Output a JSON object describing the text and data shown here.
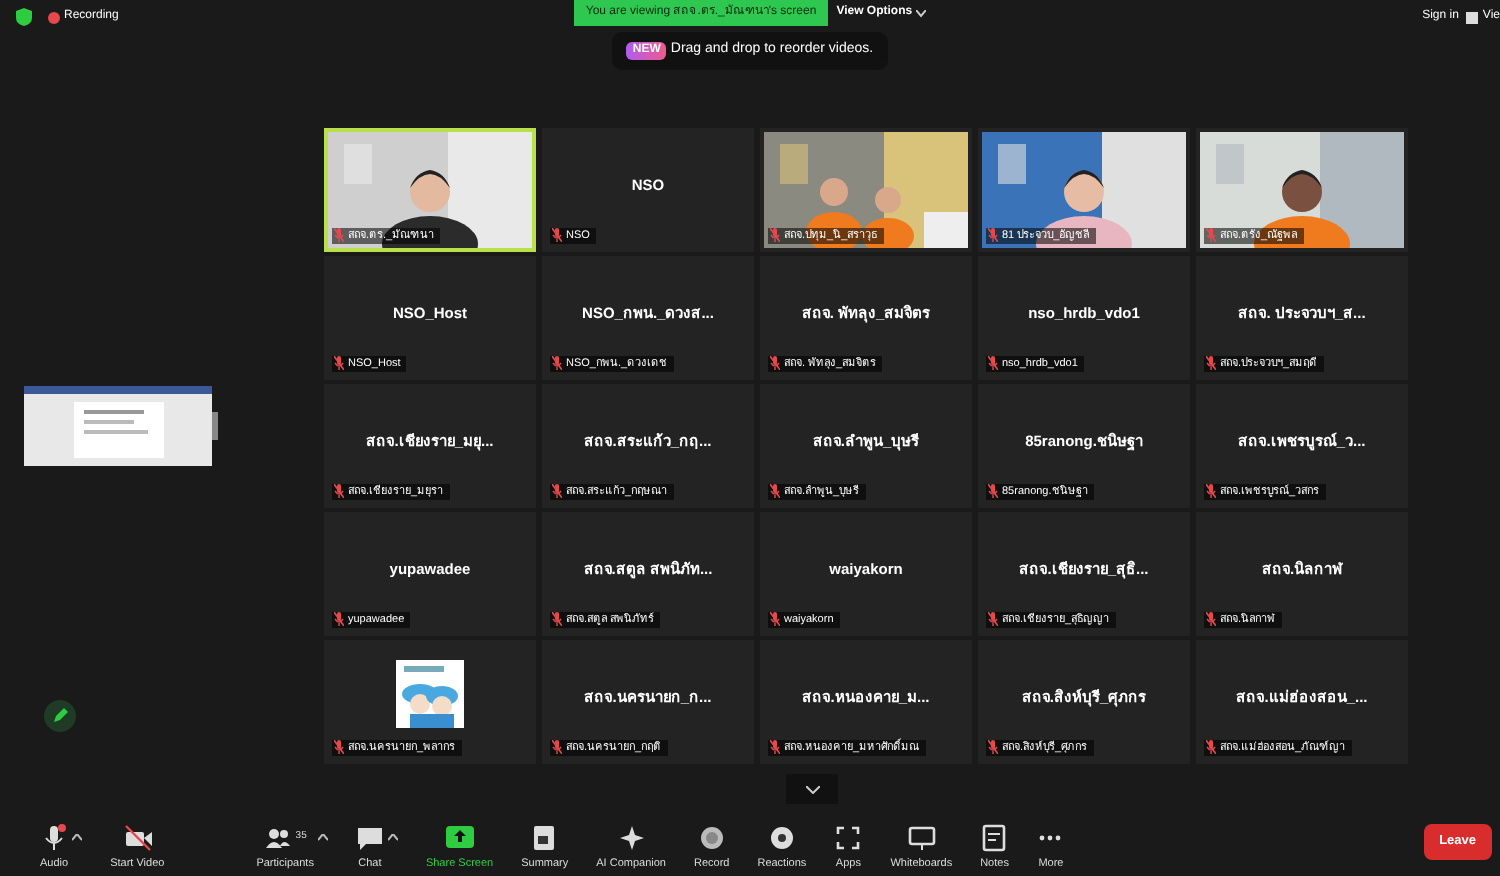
{
  "top_bar": {
    "recording_label": "Recording",
    "banner": "You are viewing สถจ.ตร._มัณฑนา's screen",
    "view_options": "View Options",
    "tip_badge": "NEW",
    "tip": "Drag and drop to reorder videos.",
    "sign_in": "Sign in",
    "view": "Vie"
  },
  "tiles": [
    {
      "kind": "video",
      "tag": "สถจ.ตร._มัณฑนา",
      "muted": true,
      "speaking": true
    },
    {
      "kind": "name",
      "name": "NSO",
      "tag": "NSO",
      "muted": true,
      "speaking": false
    },
    {
      "kind": "video",
      "tag": "สถจ.ปทุม_นิ_สราวุธ",
      "muted": true,
      "speaking": false
    },
    {
      "kind": "video",
      "tag": "81 ประจวบ_อัญชลี",
      "muted": true,
      "speaking": false
    },
    {
      "kind": "video",
      "tag": "สถจ.ตรัง_ณัฐพล",
      "muted": true,
      "speaking": false
    },
    {
      "kind": "name",
      "name": "NSO_Host",
      "tag": "NSO_Host",
      "muted": true,
      "speaking": false
    },
    {
      "kind": "name",
      "name": "NSO_กพน._ดวงส...",
      "tag": "NSO_กพน._ดวงเดช",
      "muted": true,
      "speaking": false
    },
    {
      "kind": "name",
      "name": "สถจ. พัทลุง_สมจิตร",
      "tag": "สถจ. พัทลุง_สมจิตร",
      "muted": true,
      "speaking": false
    },
    {
      "kind": "name",
      "name": "nso_hrdb_vdo1",
      "tag": "nso_hrdb_vdo1",
      "muted": true,
      "speaking": false
    },
    {
      "kind": "name",
      "name": "สถจ. ประจวบฯ_ส...",
      "tag": "สถจ.ประจวบฯ_สมฤดี",
      "muted": true,
      "speaking": false
    },
    {
      "kind": "name",
      "name": "สถจ.เชียงราย_มยุ...",
      "tag": "สถจ.เชียงราย_มยุรา",
      "muted": true,
      "speaking": false
    },
    {
      "kind": "name",
      "name": "สถจ.สระแก้ว_กฤ...",
      "tag": "สถจ.สระแก้ว_กฤษณา",
      "muted": true,
      "speaking": false
    },
    {
      "kind": "name",
      "name": "สถจ.ลำพูน_บุษรี",
      "tag": "สถจ.ลำพูน_บุษรี",
      "muted": true,
      "speaking": false
    },
    {
      "kind": "name",
      "name": "85ranong.ชนิษฐา",
      "tag": "85ranong.ชนิษฐา",
      "muted": true,
      "speaking": false
    },
    {
      "kind": "name",
      "name": "สถจ.เพชรบูรณ์_ว...",
      "tag": "สถจ.เพชรบูรณ์_วสกร",
      "muted": true,
      "speaking": false
    },
    {
      "kind": "name",
      "name": "yupawadee",
      "tag": "yupawadee",
      "muted": true,
      "speaking": false
    },
    {
      "kind": "name",
      "name": "สถจ.สตูล สพนิภัท...",
      "tag": "สถจ.สตูล สพนิภัทร์",
      "muted": true,
      "speaking": false
    },
    {
      "kind": "name",
      "name": "waiyakorn",
      "tag": "waiyakorn",
      "muted": true,
      "speaking": false
    },
    {
      "kind": "name",
      "name": "สถจ.เชียงราย_สุธิ...",
      "tag": "สถจ.เชียงราย_สุธิญญา",
      "muted": true,
      "speaking": false
    },
    {
      "kind": "name",
      "name": "สถจ.นิลกาฬ",
      "tag": "สถจ.นิลกาฬ",
      "muted": true,
      "speaking": false
    },
    {
      "kind": "avatar",
      "tag": "สถจ.นครนายก_พลากร",
      "muted": true,
      "speaking": false
    },
    {
      "kind": "name",
      "name": "สถจ.นครนายก_ก...",
      "tag": "สถจ.นครนายก_กฤติ",
      "muted": true,
      "speaking": false
    },
    {
      "kind": "name",
      "name": "สถจ.หนองคาย_ม...",
      "tag": "สถจ.หนองคาย_มหาศักดิ์มณ",
      "muted": true,
      "speaking": false
    },
    {
      "kind": "name",
      "name": "สถจ.สิงห์บุรี_ศุภกร",
      "tag": "สถจ.สิงห์บุรี_ศุภกร",
      "muted": true,
      "speaking": false
    },
    {
      "kind": "name",
      "name": "สถจ.แม่ฮ่องสอน_...",
      "tag": "สถจ.แม่ฮ่องสอน_ภัณฑ์ญา",
      "muted": true,
      "speaking": false
    }
  ],
  "toolbar": [
    {
      "kind": "audio",
      "label": "Audio",
      "caret": true,
      "active": false
    },
    {
      "kind": "video",
      "label": "Start Video",
      "caret": false,
      "active": false
    },
    {
      "kind": "participants",
      "label": "Participants",
      "count": "35",
      "caret": true,
      "active": false
    },
    {
      "kind": "chat",
      "label": "Chat",
      "caret": true,
      "active": false
    },
    {
      "kind": "share",
      "label": "Share Screen",
      "caret": false,
      "active": true
    },
    {
      "kind": "summary",
      "label": "Summary",
      "caret": false,
      "active": false
    },
    {
      "kind": "ai",
      "label": "AI Companion",
      "caret": false,
      "active": false
    },
    {
      "kind": "record",
      "label": "Record",
      "caret": false,
      "active": false
    },
    {
      "kind": "reactions",
      "label": "Reactions",
      "caret": false,
      "active": false
    },
    {
      "kind": "apps",
      "label": "Apps",
      "caret": false,
      "active": false
    },
    {
      "kind": "whiteboard",
      "label": "Whiteboards",
      "caret": false,
      "active": false
    },
    {
      "kind": "notes",
      "label": "Notes",
      "caret": false,
      "active": false
    },
    {
      "kind": "more",
      "label": "More",
      "caret": false,
      "active": false
    }
  ],
  "leave": "Leave"
}
